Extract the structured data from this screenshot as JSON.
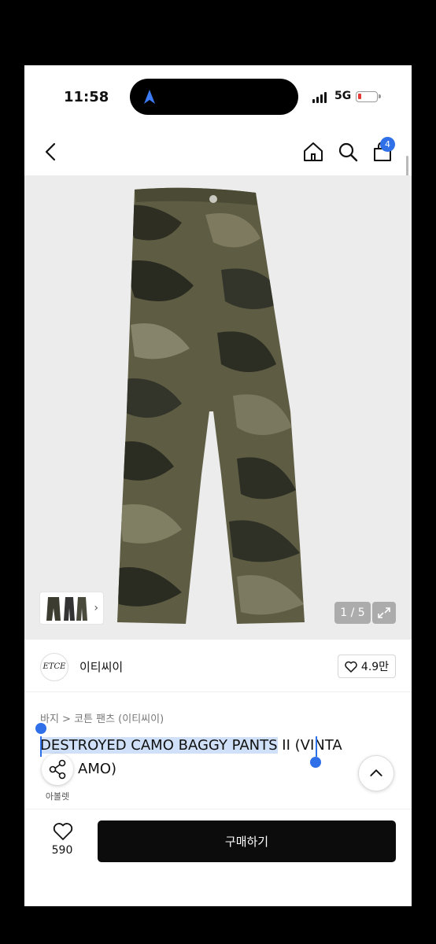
{
  "status_bar": {
    "time": "11:58",
    "network": "5G"
  },
  "nav": {
    "cart_count": "4"
  },
  "gallery": {
    "counter": "1 / 5"
  },
  "brand": {
    "logo_text": "ETCE",
    "name": "이티씨이",
    "likes": "4.9만"
  },
  "product": {
    "breadcrumb": "바지 > 코튼 팬츠 (이티씨이)",
    "title_selected": "DESTROYED CAMO BAGGY PANTS",
    "title_rest_line1": " II (VINTA",
    "title_line2_visible": "AMO)"
  },
  "share": {
    "label": "아볼렛"
  },
  "bottom": {
    "wish_count": "590",
    "buy_label": "구매하기"
  },
  "colors": {
    "accent": "#2f6fe8",
    "buy_button": "#0c0c0c",
    "selection": "#cfe0f8",
    "camo_base": "#5a5a40"
  }
}
